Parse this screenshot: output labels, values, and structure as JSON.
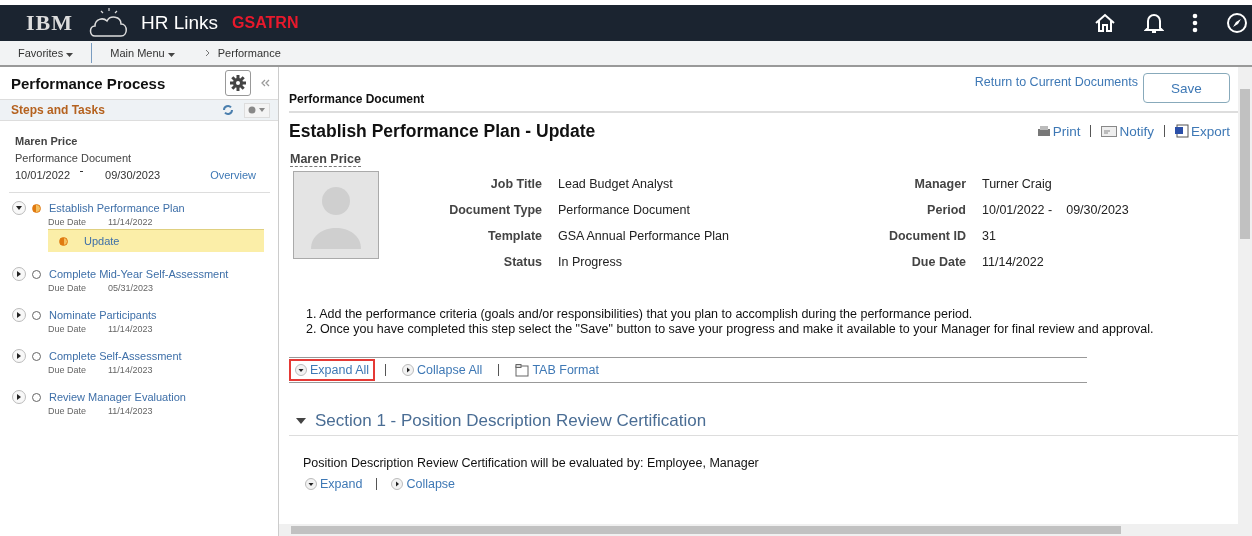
{
  "header": {
    "logo": "IBM",
    "product": "HR Links",
    "environment": "GSATRN"
  },
  "nav": {
    "items": [
      {
        "label": "Favorites",
        "kind": "menu"
      },
      {
        "label": "Main Menu",
        "kind": "menu"
      },
      {
        "label": "Performance",
        "kind": "crumb"
      }
    ]
  },
  "sidebar": {
    "title": "Performance Process",
    "section": "Steps and Tasks",
    "employee": "Maren Price",
    "document": "Performance Document",
    "period_start": "10/01/2022",
    "period_end": "09/30/2023",
    "overview_link": "Overview",
    "steps": [
      {
        "label": "Establish Performance Plan",
        "kind": "in_progress",
        "expanded": true,
        "due_label": "Due Date",
        "due": "11/14/2022",
        "children": [
          {
            "label": "Update",
            "kind": "in_progress",
            "selected": true
          }
        ]
      },
      {
        "label": "Complete Mid-Year Self-Assessment",
        "kind": "not_started",
        "expanded": false,
        "due_label": "Due Date",
        "due": "05/31/2023"
      },
      {
        "label": "Nominate Participants",
        "kind": "not_started",
        "expanded": false,
        "due_label": "Due Date",
        "due": "11/14/2023"
      },
      {
        "label": "Complete Self-Assessment",
        "kind": "not_started",
        "expanded": false,
        "due_label": "Due Date",
        "due": "11/14/2023"
      },
      {
        "label": "Review Manager Evaluation",
        "kind": "not_started",
        "expanded": false,
        "due_label": "Due Date",
        "due": "11/14/2023"
      }
    ]
  },
  "main": {
    "section_label": "Performance Document",
    "return_link": "Return to Current Documents",
    "save_button": "Save",
    "title": "Establish Performance Plan - Update",
    "employee": "Maren Price",
    "actions": [
      {
        "label": "Print",
        "kind": "print"
      },
      {
        "label": "Notify",
        "kind": "notify"
      },
      {
        "label": "Export",
        "kind": "export"
      }
    ],
    "left_fields": [
      {
        "label": "Job Title",
        "value": "Lead Budget Analyst"
      },
      {
        "label": "Document Type",
        "value": "Performance Document"
      },
      {
        "label": "Template",
        "value": "GSA Annual Performance Plan"
      },
      {
        "label": "Status",
        "value": "In Progress"
      }
    ],
    "right_fields": [
      {
        "label": "Manager",
        "value": "Turner Craig"
      },
      {
        "label": "Period",
        "value": "10/01/2022 -",
        "value_2": "09/30/2023"
      },
      {
        "label": "Document ID",
        "value": "31"
      },
      {
        "label": "Due Date",
        "value": "11/14/2022"
      }
    ],
    "instructions": [
      "1. Add the performance criteria (goals and/or responsibilities) that you plan to accomplish during the performance period.",
      "2. Once you have completed this step select the \"Save\" button to save your progress and make it available to your Manager for final review and approval."
    ],
    "toolbar": [
      {
        "label": "Expand All",
        "kind": "expand",
        "highlighted": true
      },
      {
        "label": "Collapse All",
        "kind": "collapse",
        "highlighted": false
      },
      {
        "label": "TAB Format",
        "kind": "tab",
        "highlighted": false
      }
    ],
    "section": {
      "title": "Section 1 - Position Description Review Certification",
      "expanded": true,
      "evaluated_by": "Position Description Review Certification will be evaluated by: Employee, Manager",
      "links": [
        {
          "label": "Expand",
          "kind": "expand"
        },
        {
          "label": "Collapse",
          "kind": "collapse"
        }
      ]
    }
  }
}
